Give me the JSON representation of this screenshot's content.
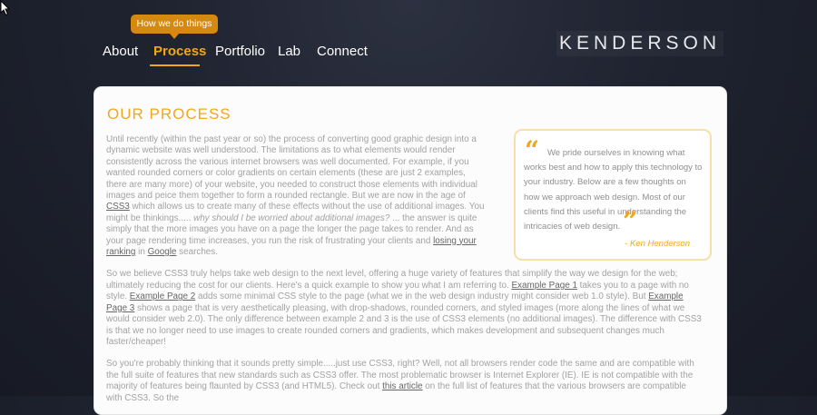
{
  "tooltip": {
    "label": "How we do things"
  },
  "nav": {
    "items": [
      "About",
      "Process",
      "Portfolio",
      "Lab",
      "Connect"
    ]
  },
  "logo": {
    "text": "KENDERSON"
  },
  "section": {
    "title": "OUR PROCESS"
  },
  "paragraph1": {
    "t1": "Until recently (within the past year or so) the process of converting good graphic design into a dynamic website was well understood. The limitations as to what elements would render consistently across the various internet browsers was well documented. For example, if you wanted rounded corners or color gradients on certain elements (these are just 2 examples, there are many more) of your website, you needed to construct those elements with individual images and peice them together to form a rounded rectangle. But we are now in the age of ",
    "link_css3": "CSS3",
    "t2": " which allows us to create many of these effects without the use of additional images. You might be thinkings..... ",
    "em": "why should I be worried about additional images?",
    "t3": " ... the answer is quite simply that the more images you have on a page the longer the page takes to render. And as your page rendering time increases, you run the risk of frustrating your clients and ",
    "link_ranking": "losing your ranking",
    "t4": " in ",
    "link_google": "Google",
    "t5": " searches."
  },
  "paragraph2": {
    "t1": "So we believe CSS3 truly helps take web design to the next level, offering a huge variety of features that simplify the way we design for the web; ultimately reducing the cost for our clients. Here's a quick example to show you what I am referring to. ",
    "link1": "Example Page 1",
    "t2": " takes you to a page with no style. ",
    "link2": "Example Page 2",
    "t3": " adds some minimal CSS style to the page (what we in the web design industry might consider web 1.0 style). But ",
    "link3": "Example Page 3",
    "t4": " shows a page that is very aesthetically pleasing, with drop-shadows, rounded corners, and styled images (more along the lines of what we would consider web 2.0). The only difference between example 2 and 3 is the use of CSS3 elements (no additional images). The difference with CSS3 is that we no longer need to use images to create rounded corners and gradients, which makes development and subsequent changes much faster/cheaper!"
  },
  "paragraph3": {
    "t1": "So you're probably thinking that it sounds pretty simple.....just use CSS3, right? Well, not all browsers render code the same and are compatible with the full suite of features that new standards such as CSS3 offer. The most problematic browser is Internet Explorer (IE). IE is not compatible with the majority of features being flaunted by CSS3 (and HTML5). Check out ",
    "link": "this article",
    "t2": " on the full list of features that the various browsers are compatible with CSS3. So the"
  },
  "quote": {
    "open_mark": "“",
    "text": "We pride ourselves in knowing what works best and how to apply this technology to your industry. Below are a few thoughts on how we approach web design. Most of our clients find this useful in understanding the intricacies of web design.",
    "close_mark": "”",
    "author": "- Ken Henderson"
  }
}
